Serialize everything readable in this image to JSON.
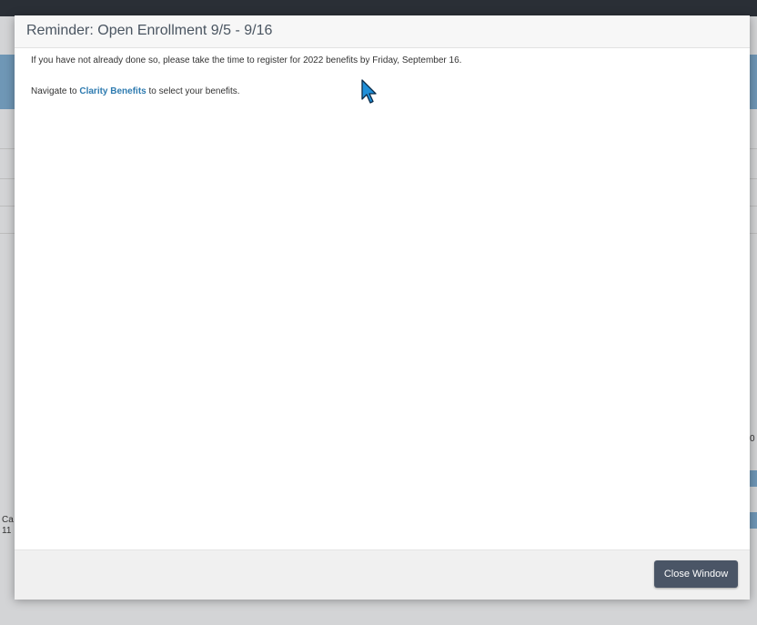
{
  "background": {
    "side_text_1": "Ca",
    "side_text_2": "11",
    "right_text": "0"
  },
  "modal": {
    "title": "Reminder: Open Enrollment 9/5 - 9/16",
    "paragraph_1": "If you have not already done so, please take the time to register for 2022 benefits by Friday, September 16.",
    "paragraph_2_prefix": "Navigate to ",
    "paragraph_2_link": "Clarity Benefits",
    "paragraph_2_suffix": " to select your benefits.",
    "close_button_label": "Close Window"
  },
  "colors": {
    "link": "#2e7bb0",
    "button": "#4a5566",
    "cursor": "#1f8fd8"
  },
  "icons": {
    "cursor": "mouse-pointer-icon"
  }
}
